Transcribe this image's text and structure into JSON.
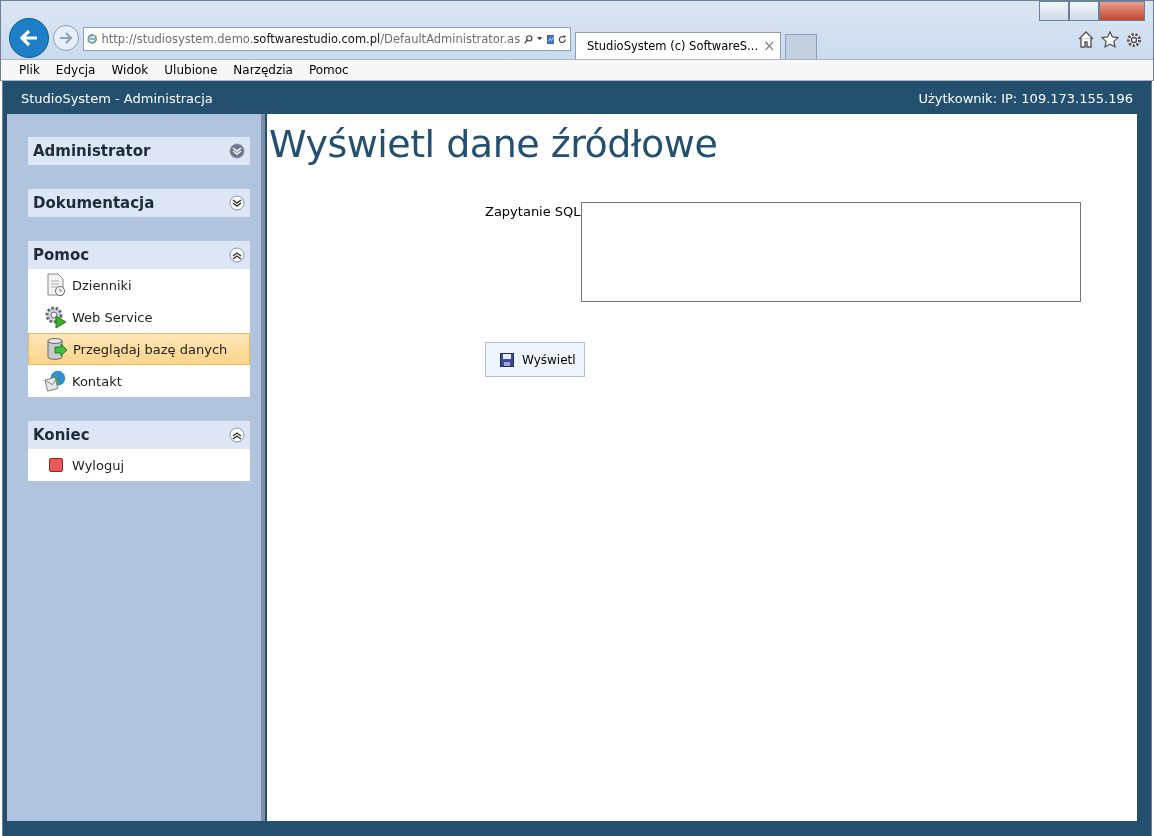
{
  "browser": {
    "url_prefix": "http://studiosystem.demo.",
    "url_domain": "softwarestudio.com.pl",
    "url_path": "/DefaultAdministrator.as",
    "tab_title": "StudioSystem (c) SoftwareS...",
    "tab_close": "×",
    "menu": [
      "Plik",
      "Edycja",
      "Widok",
      "Ulubione",
      "Narzędzia",
      "Pomoc"
    ]
  },
  "app": {
    "title": "StudioSystem - Administracja",
    "user": "Użytkownik: IP: 109.173.155.196"
  },
  "sidebar": {
    "sections": [
      {
        "title": "Administrator",
        "expanded": false
      },
      {
        "title": "Dokumentacja",
        "expanded": false
      },
      {
        "title": "Pomoc",
        "expanded": true,
        "items": [
          {
            "label": "Dzienniki",
            "kind": "log",
            "selected": false
          },
          {
            "label": "Web Service",
            "kind": "service",
            "selected": false
          },
          {
            "label": "Przeglądaj bazę danych",
            "kind": "database",
            "selected": true
          },
          {
            "label": "Kontakt",
            "kind": "contact",
            "selected": false
          }
        ]
      },
      {
        "title": "Koniec",
        "expanded": true,
        "items": [
          {
            "label": "Wyloguj",
            "kind": "logout",
            "selected": false
          }
        ]
      }
    ]
  },
  "main": {
    "heading": "Wyświetl dane źródłowe",
    "field_label": "Zapytanie SQL",
    "button": "Wyświetl"
  }
}
